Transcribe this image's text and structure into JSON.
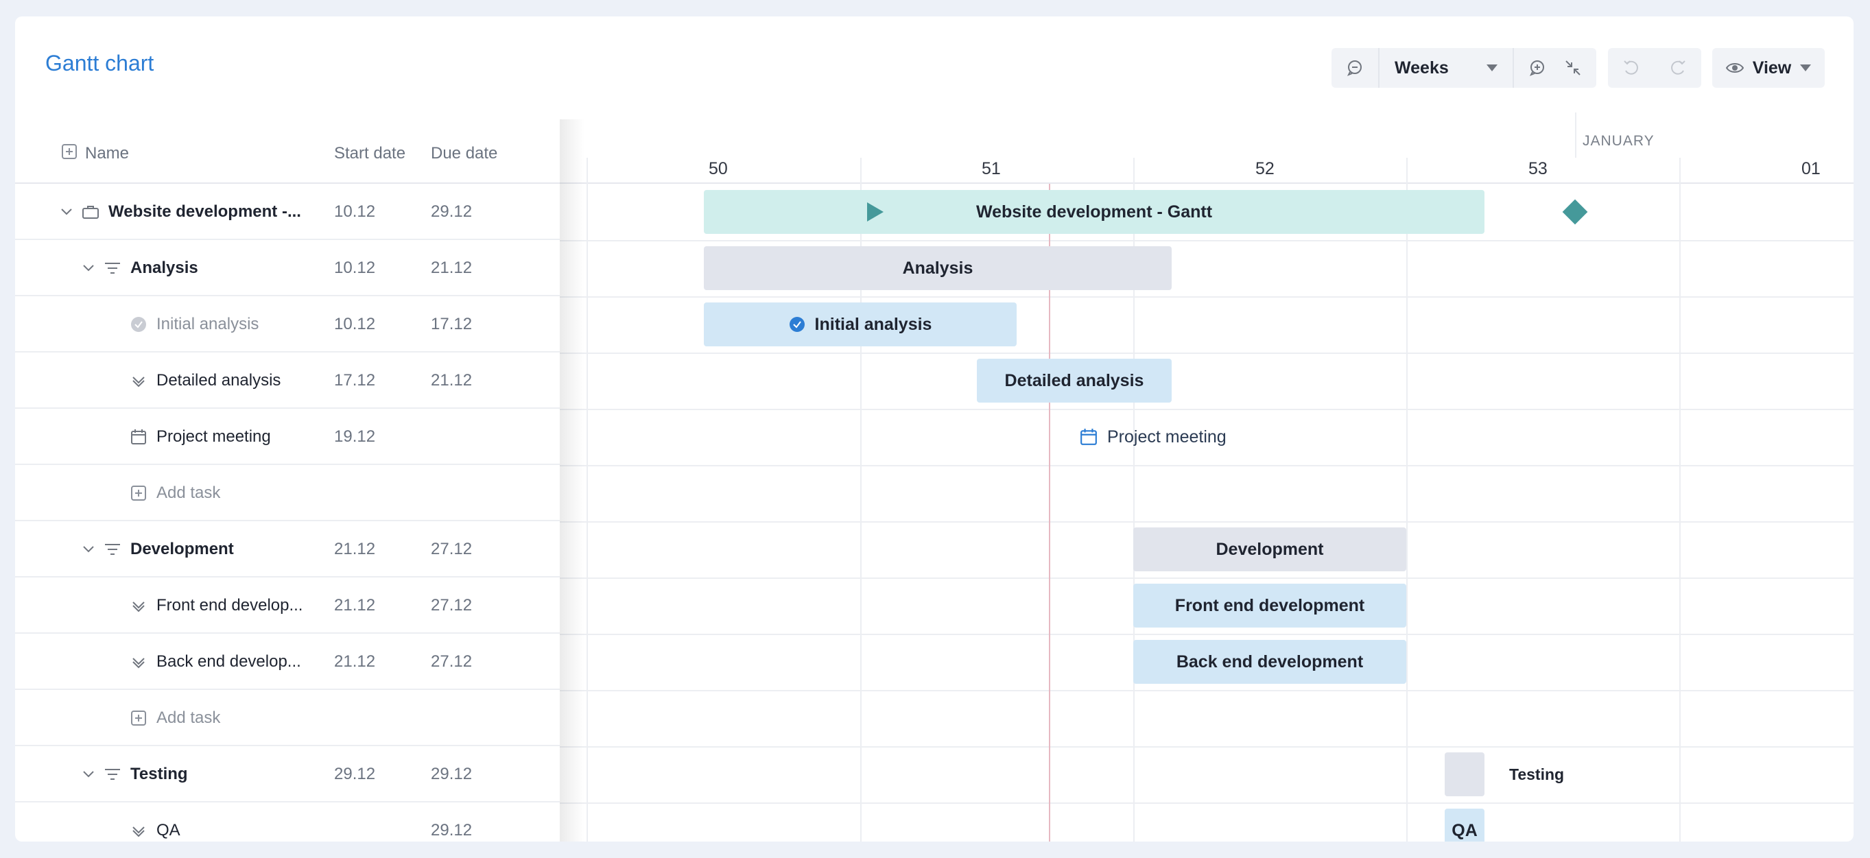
{
  "header": {
    "title": "Gantt chart",
    "zoom_unit": "Weeks",
    "view_label": "View"
  },
  "columns": {
    "name": "Name",
    "start": "Start date",
    "due": "Due date"
  },
  "rows": [
    {
      "name": "Website development -...",
      "start": "10.12",
      "due": "29.12"
    },
    {
      "name": "Analysis",
      "start": "10.12",
      "due": "21.12"
    },
    {
      "name": "Initial analysis",
      "start": "10.12",
      "due": "17.12"
    },
    {
      "name": "Detailed analysis",
      "start": "17.12",
      "due": "21.12"
    },
    {
      "name": "Project meeting",
      "start": "19.12",
      "due": ""
    },
    {
      "name": "Add task",
      "start": "",
      "due": ""
    },
    {
      "name": "Development",
      "start": "21.12",
      "due": "27.12"
    },
    {
      "name": "Front end develop...",
      "start": "21.12",
      "due": "27.12"
    },
    {
      "name": "Back end develop...",
      "start": "21.12",
      "due": "27.12"
    },
    {
      "name": "Add task",
      "start": "",
      "due": ""
    },
    {
      "name": "Testing",
      "start": "29.12",
      "due": "29.12"
    },
    {
      "name": "QA",
      "start": "",
      "due": "29.12"
    }
  ],
  "timescale": {
    "month": "JANUARY",
    "weeks": [
      "50",
      "51",
      "52",
      "53",
      "01"
    ]
  },
  "bars": {
    "project": "Website development - Gantt",
    "analysis": "Analysis",
    "initial": "Initial analysis",
    "detailed": "Detailed analysis",
    "meeting": "Project meeting",
    "development": "Development",
    "frontend": "Front end development",
    "backend": "Back end development",
    "testing": "Testing",
    "qa": "QA"
  },
  "colors": {
    "accent": "#2c7dd4",
    "project_bar": "#d0eeec",
    "group_bar": "#e1e4ec",
    "task_bar": "#d2e7f6",
    "milestone": "#45999a",
    "today_line": "#e6b9c2"
  }
}
